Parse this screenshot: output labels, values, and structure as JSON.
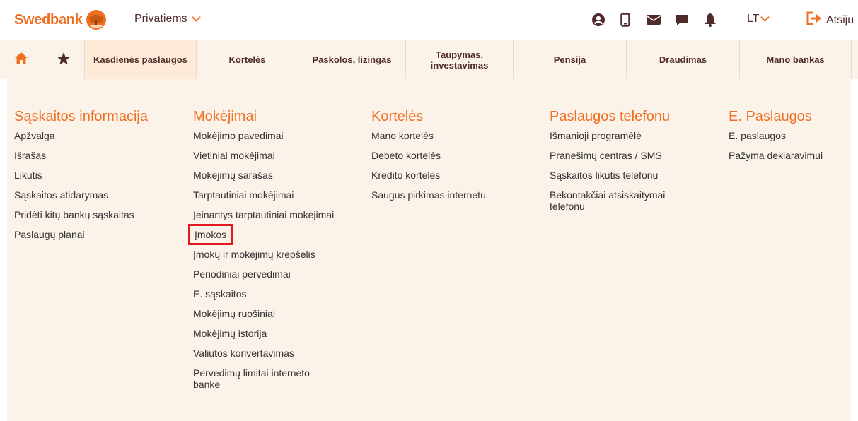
{
  "header": {
    "logo_text": "Swedbank",
    "segment_label": "Privatiems",
    "language": "LT",
    "logout_label": "Atsiju",
    "icons": [
      "user-icon",
      "mobile-icon",
      "mail-icon",
      "chat-icon",
      "bell-icon",
      "logout-icon"
    ]
  },
  "nav": {
    "items": [
      {
        "label": ""
      },
      {
        "label": ""
      },
      {
        "label": "Kasdienės paslaugos"
      },
      {
        "label": "Kortelės"
      },
      {
        "label": "Paskolos, lizingas"
      },
      {
        "label": "Taupymas, investavimas"
      },
      {
        "label": "Pensija"
      },
      {
        "label": "Draudimas"
      },
      {
        "label": "Mano bankas"
      }
    ],
    "active_index": 2
  },
  "menu": {
    "columns": [
      {
        "title": "Sąskaitos informacija",
        "items": [
          "Apžvalga",
          "Išrašas",
          "Likutis",
          "Sąskaitos atidarymas",
          "Pridėti kitų bankų sąskaitas",
          "Paslaugų planai"
        ]
      },
      {
        "title": "Mokėjimai",
        "items": [
          "Mokėjimo pavedimai",
          "Vietiniai mokėjimai",
          "Mokėjimų sarašas",
          "Tarptautiniai mokėjimai",
          "Įeinantys tarptautiniai mokėjimai",
          "Įmokos",
          "Įmokų ir mokėjimų krepšelis",
          "Periodiniai pervedimai",
          "E. sąskaitos",
          "Mokėjimų ruošiniai",
          "Mokėjimų istorija",
          "Valiutos konvertavimas",
          "Pervedimų limitai interneto banke"
        ]
      },
      {
        "title": "Kortelės",
        "items": [
          "Mano kortelės",
          "Debeto kortelės",
          "Kredito kortelės",
          "Saugus pirkimas internetu"
        ]
      },
      {
        "title": "Paslaugos telefonu",
        "items": [
          "Išmanioji programėlė",
          "Pranešimų centras / SMS",
          "Sąskaitos likutis telefonu",
          "Bekontakčiai atsiskaitymai telefonu"
        ]
      },
      {
        "title": "E. Paslaugos",
        "items": [
          "E. paslaugos",
          "Pažyma deklaravimui"
        ]
      }
    ],
    "highlighted_item": "Įmokos",
    "highlight_color": "#e4191f"
  },
  "colors": {
    "brand_orange": "#ee7023",
    "brown_text": "#512b2b",
    "menu_background": "#fbf2ea"
  }
}
